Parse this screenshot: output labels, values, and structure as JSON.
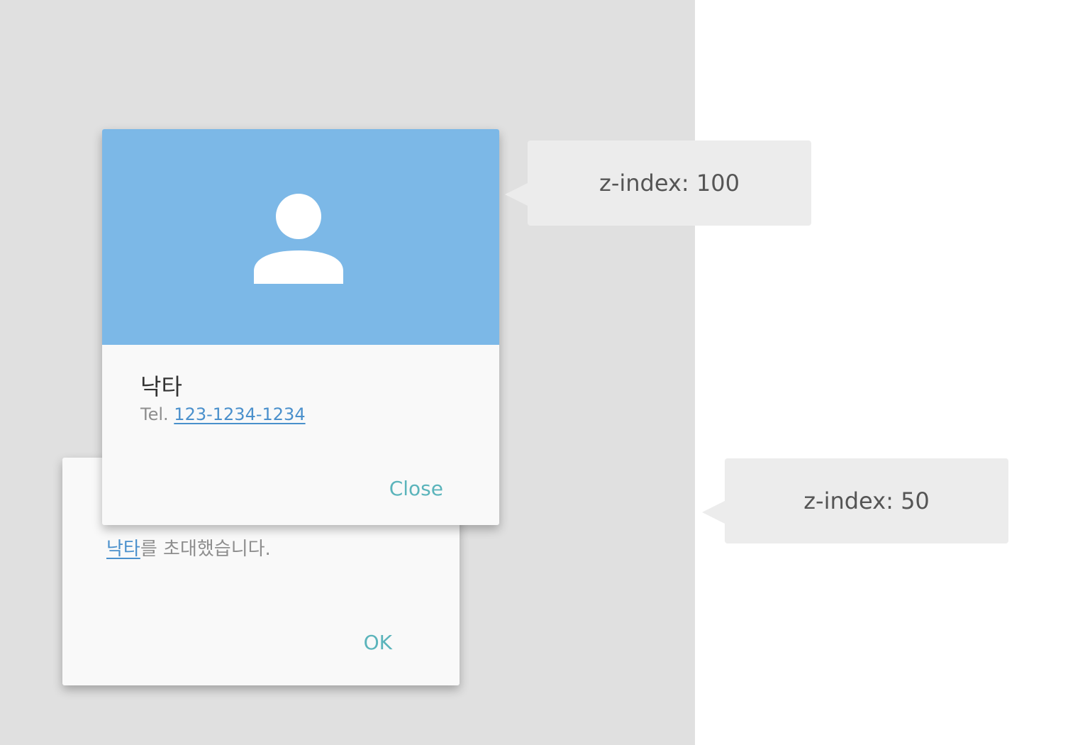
{
  "colors": {
    "page_bg": "#ffffff",
    "gray_panel": "#e0e0e0",
    "dialog_bg": "#f9f9f9",
    "header_blue": "#7cb8e7",
    "link_blue": "#4a90cc",
    "action_teal": "#5bb4bb",
    "callout_bg": "#ececec"
  },
  "profile_dialog": {
    "avatar_icon": "person-icon",
    "name": "낙타",
    "tel_prefix": "Tel.",
    "phone": "123-1234-1234",
    "close_label": "Close"
  },
  "invite_dialog": {
    "name_link": "낙타",
    "message_suffix": "를 초대했습니다.",
    "ok_label": "OK"
  },
  "callouts": {
    "top": "z-index: 100",
    "bottom": "z-index: 50"
  }
}
